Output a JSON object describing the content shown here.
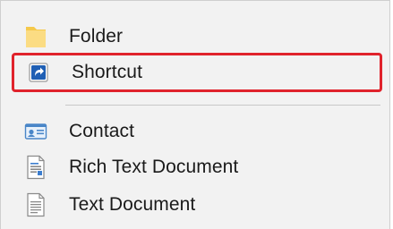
{
  "menu": {
    "items": [
      {
        "label": "Folder",
        "icon": "folder-icon"
      },
      {
        "label": "Shortcut",
        "icon": "shortcut-icon",
        "highlighted": true
      },
      {
        "label": "Contact",
        "icon": "contact-card-icon"
      },
      {
        "label": "Rich Text Document",
        "icon": "rich-text-document-icon"
      },
      {
        "label": "Text Document",
        "icon": "text-document-icon"
      }
    ]
  },
  "colors": {
    "background": "#f2f2f2",
    "highlight_border": "#e0232c",
    "folder": "#f9d66e",
    "shortcut": "#1f5fb4",
    "text": "#1a1a1a"
  }
}
